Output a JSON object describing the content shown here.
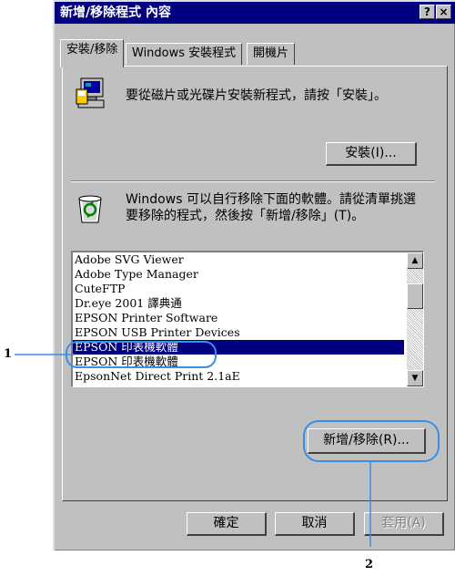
{
  "window": {
    "title": "新增/移除程式 內容",
    "help_button": "?",
    "close_button": "×"
  },
  "tabs": [
    {
      "label": "安裝/移除",
      "active": true
    },
    {
      "label": "Windows 安裝程式",
      "active": false
    },
    {
      "label": "開機片",
      "active": false
    }
  ],
  "install_section": {
    "icon": "computer-install-icon",
    "text": "要從磁片或光碟片安裝新程式，請按「安裝」。",
    "install_button": "安裝(I)..."
  },
  "remove_section": {
    "icon": "recycle-bin-icon",
    "text_line1": "Windows 可以自行移除下面的軟體。請從清單挑選",
    "text_line2": "要移除的程式，然後按「新增/移除」(T)。",
    "programs": [
      "Adobe SVG Viewer",
      "Adobe Type Manager",
      "CuteFTP",
      "Dr.eye 2001 譯典通",
      "EPSON Printer Software",
      "EPSON USB Printer Devices",
      "EPSON 印表機軟體",
      "EPSON 印表機軟體",
      "EpsonNet Direct Print 2.1aE"
    ],
    "selected_index": 6,
    "add_remove_button": "新增/移除(R)..."
  },
  "footer_buttons": {
    "ok": "確定",
    "cancel": "取消",
    "apply": "套用(A)"
  },
  "callouts": {
    "one": "1",
    "two": "2"
  },
  "colors": {
    "titlebar": "#000080",
    "selection": "#000080",
    "callout": "#3a8ee8"
  }
}
